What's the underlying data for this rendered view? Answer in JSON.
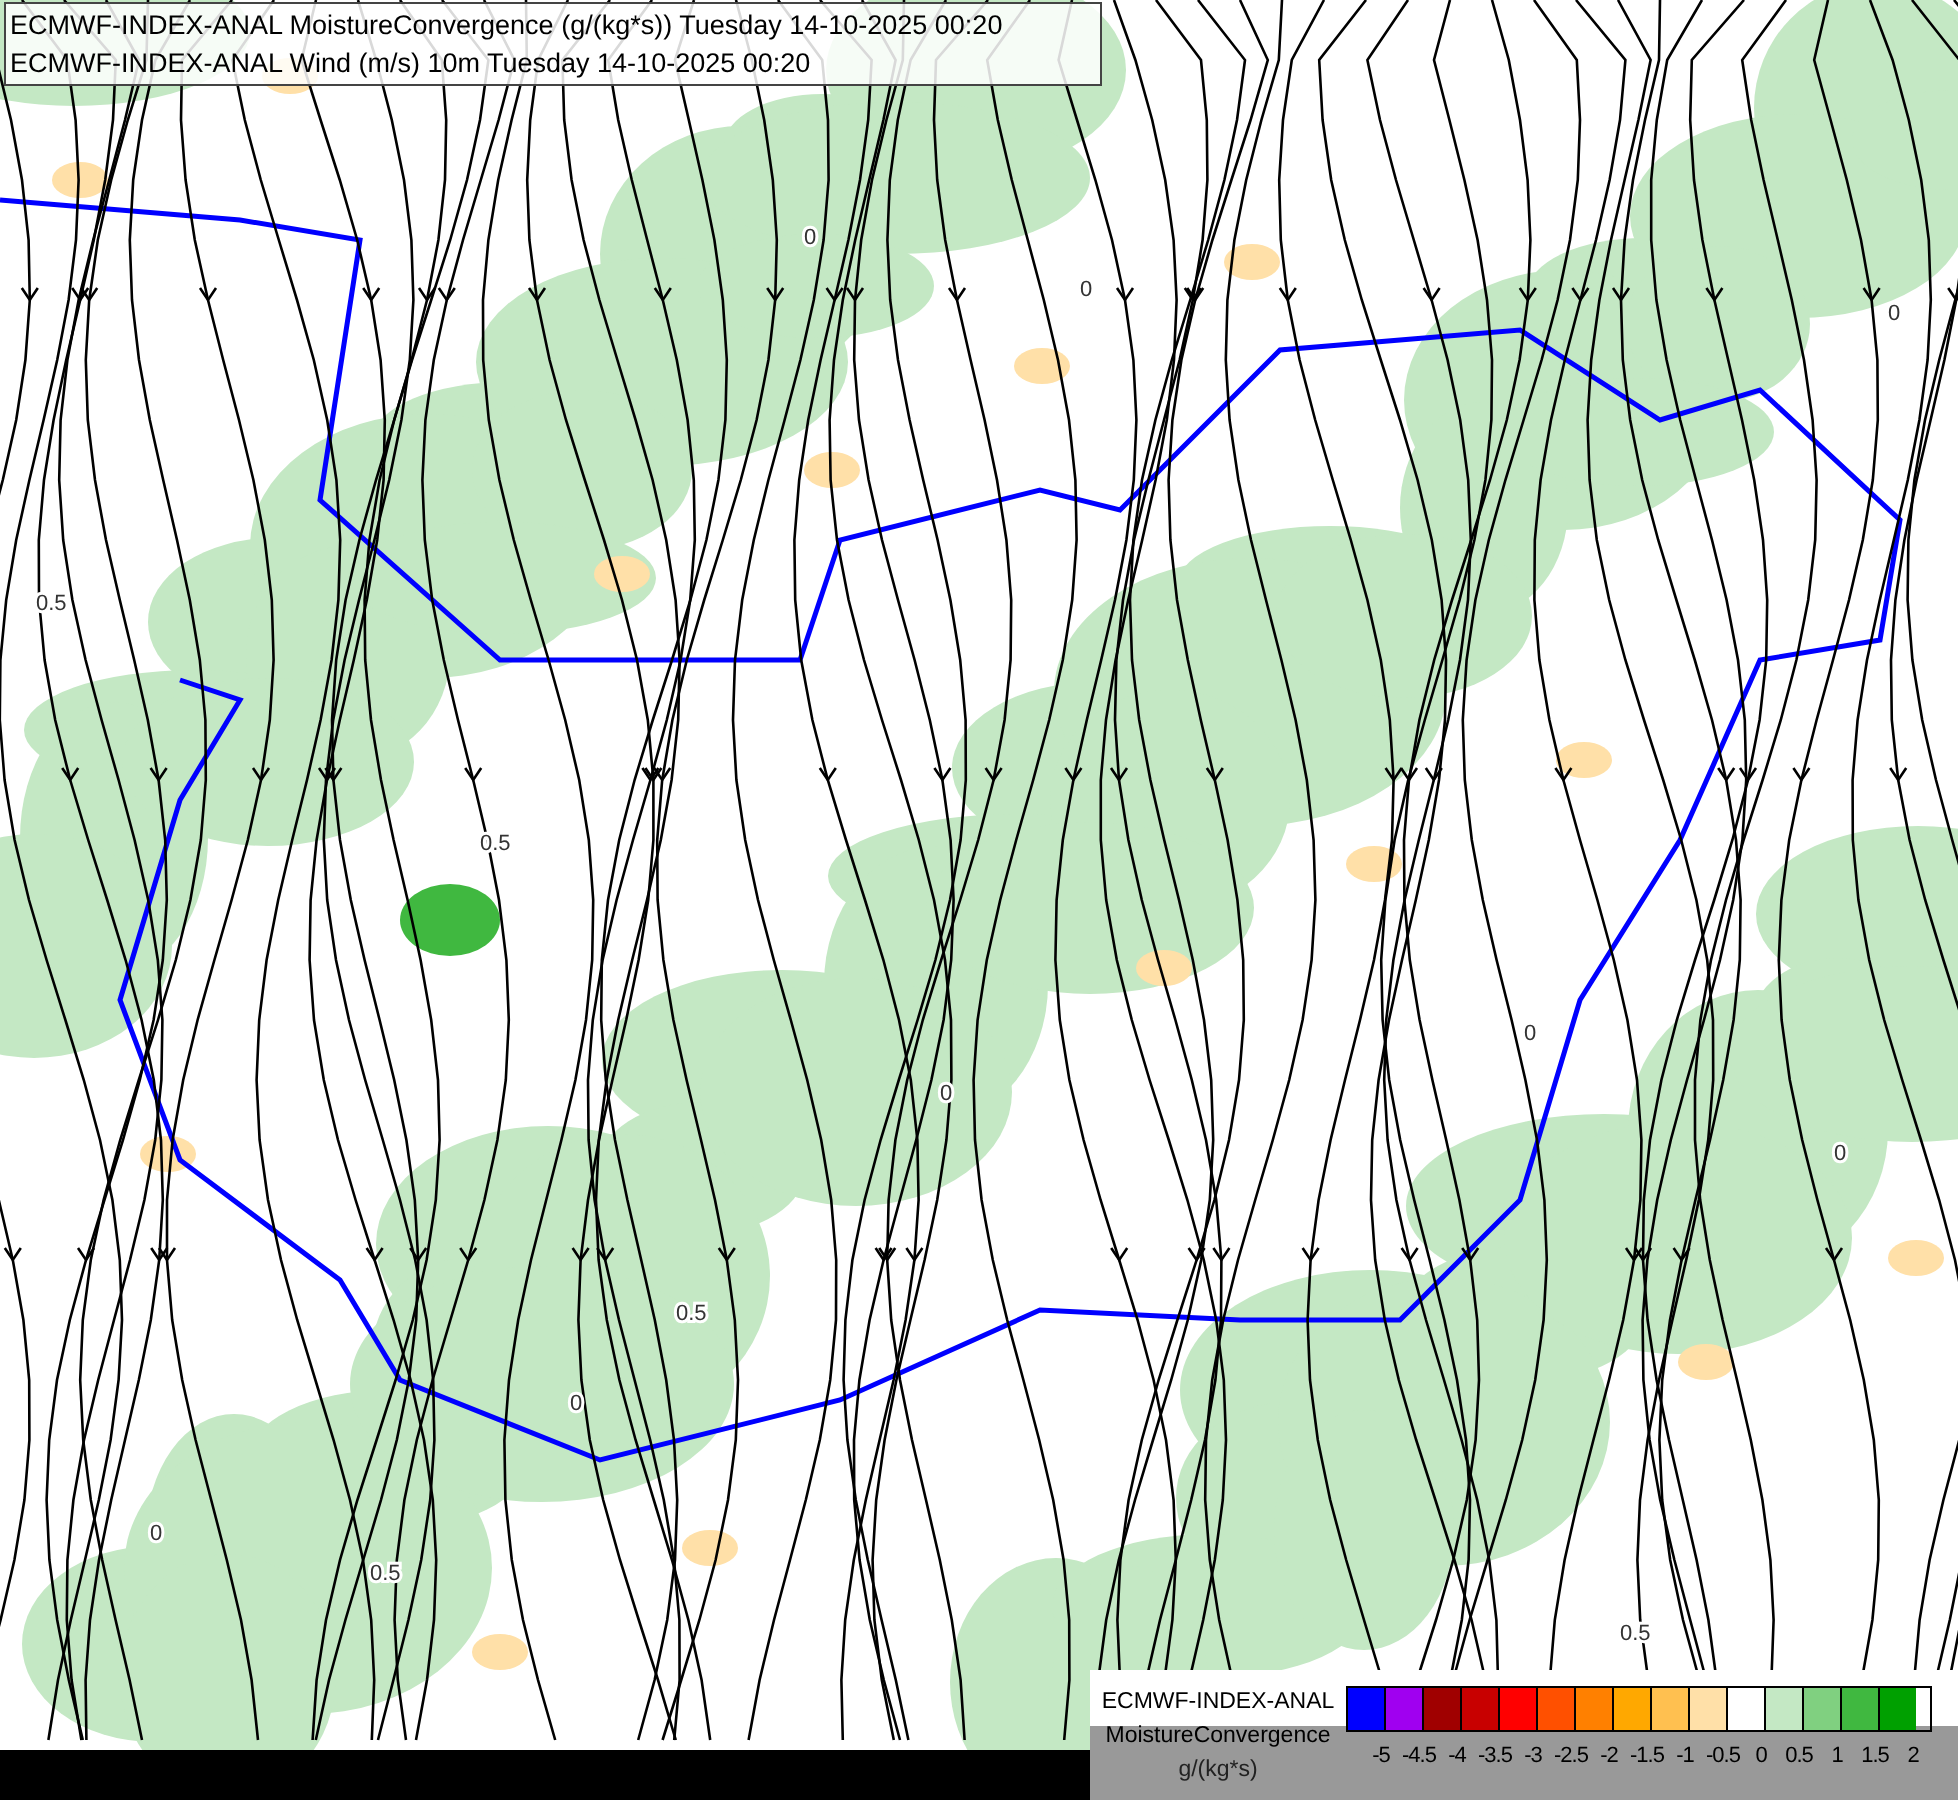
{
  "title_lines": [
    "ECMWF-INDEX-ANAL MoistureConvergence (g/(kg*s)) Tuesday 14-10-2025 00:20",
    "ECMWF-INDEX-ANAL Wind (m/s) 10m Tuesday 14-10-2025 00:20"
  ],
  "contour_labels": [
    "0",
    "0",
    "0.5",
    "0",
    "0.5",
    "0",
    "0",
    "0.5",
    "0",
    "0",
    "0.5",
    "0.5",
    "0"
  ],
  "legend": {
    "title_lines": [
      "ECMWF-INDEX-ANAL",
      "MoistureConvergence"
    ],
    "unit": "g/(kg*s)",
    "swatches": [
      {
        "color": "#0000ff",
        "label": "-5"
      },
      {
        "color": "#a000f0",
        "label": "-4.5"
      },
      {
        "color": "#a00000",
        "label": "-4"
      },
      {
        "color": "#c80000",
        "label": "-3.5"
      },
      {
        "color": "#ff0000",
        "label": "-3"
      },
      {
        "color": "#ff5000",
        "label": "-2.5"
      },
      {
        "color": "#ff8000",
        "label": "-2"
      },
      {
        "color": "#ffa800",
        "label": "-1.5"
      },
      {
        "color": "#ffc050",
        "label": "-1"
      },
      {
        "color": "#ffe0a8",
        "label": "-0.5"
      },
      {
        "color": "#ffffff",
        "label": "0"
      },
      {
        "color": "#c4e8c4",
        "label": "0.5"
      },
      {
        "color": "#80d080",
        "label": "1"
      },
      {
        "color": "#40b840",
        "label": "1.5"
      },
      {
        "color": "#00a000",
        "label": "2"
      }
    ]
  }
}
